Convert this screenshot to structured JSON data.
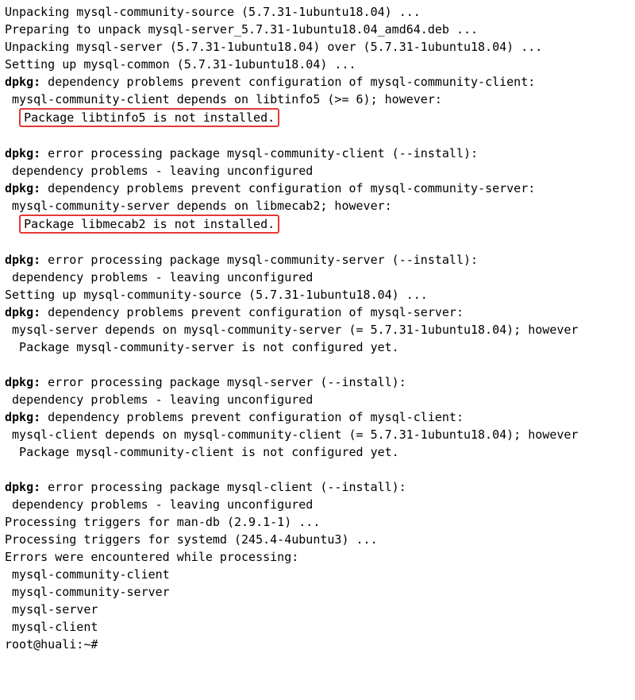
{
  "lines": {
    "l01": "Unpacking mysql-community-source (5.7.31-1ubuntu18.04) ...",
    "l02": "Preparing to unpack mysql-server_5.7.31-1ubuntu18.04_amd64.deb ...",
    "l03": "Unpacking mysql-server (5.7.31-1ubuntu18.04) over (5.7.31-1ubuntu18.04) ...",
    "l04": "Setting up mysql-common (5.7.31-1ubuntu18.04) ...",
    "l05a": "dpkg:",
    "l05b": " dependency problems prevent configuration of mysql-community-client:",
    "l06": " mysql-community-client depends on libtinfo5 (>= 6); however:",
    "l07pad": "  ",
    "l07hl": "Package libtinfo5 is not installed.",
    "l08": "",
    "l09a": "dpkg:",
    "l09b": " error processing package mysql-community-client (--install):",
    "l10": " dependency problems - leaving unconfigured",
    "l11a": "dpkg:",
    "l11b": " dependency problems prevent configuration of mysql-community-server:",
    "l12": " mysql-community-server depends on libmecab2; however:",
    "l13pad": "  ",
    "l13hl": "Package libmecab2 is not installed.",
    "l14": "",
    "l15a": "dpkg:",
    "l15b": " error processing package mysql-community-server (--install):",
    "l16": " dependency problems - leaving unconfigured",
    "l17": "Setting up mysql-community-source (5.7.31-1ubuntu18.04) ...",
    "l18a": "dpkg:",
    "l18b": " dependency problems prevent configuration of mysql-server:",
    "l19": " mysql-server depends on mysql-community-server (= 5.7.31-1ubuntu18.04); however",
    "l20": "  Package mysql-community-server is not configured yet.",
    "l21": "",
    "l22a": "dpkg:",
    "l22b": " error processing package mysql-server (--install):",
    "l23": " dependency problems - leaving unconfigured",
    "l24a": "dpkg:",
    "l24b": " dependency problems prevent configuration of mysql-client:",
    "l25": " mysql-client depends on mysql-community-client (= 5.7.31-1ubuntu18.04); however",
    "l26": "  Package mysql-community-client is not configured yet.",
    "l27": "",
    "l28a": "dpkg:",
    "l28b": " error processing package mysql-client (--install):",
    "l29": " dependency problems - leaving unconfigured",
    "l30": "Processing triggers for man-db (2.9.1-1) ...",
    "l31": "Processing triggers for systemd (245.4-4ubuntu3) ...",
    "l32": "Errors were encountered while processing:",
    "l33": " mysql-community-client",
    "l34": " mysql-community-server",
    "l35": " mysql-server",
    "l36": " mysql-client",
    "l37": "root@huali:~#"
  }
}
